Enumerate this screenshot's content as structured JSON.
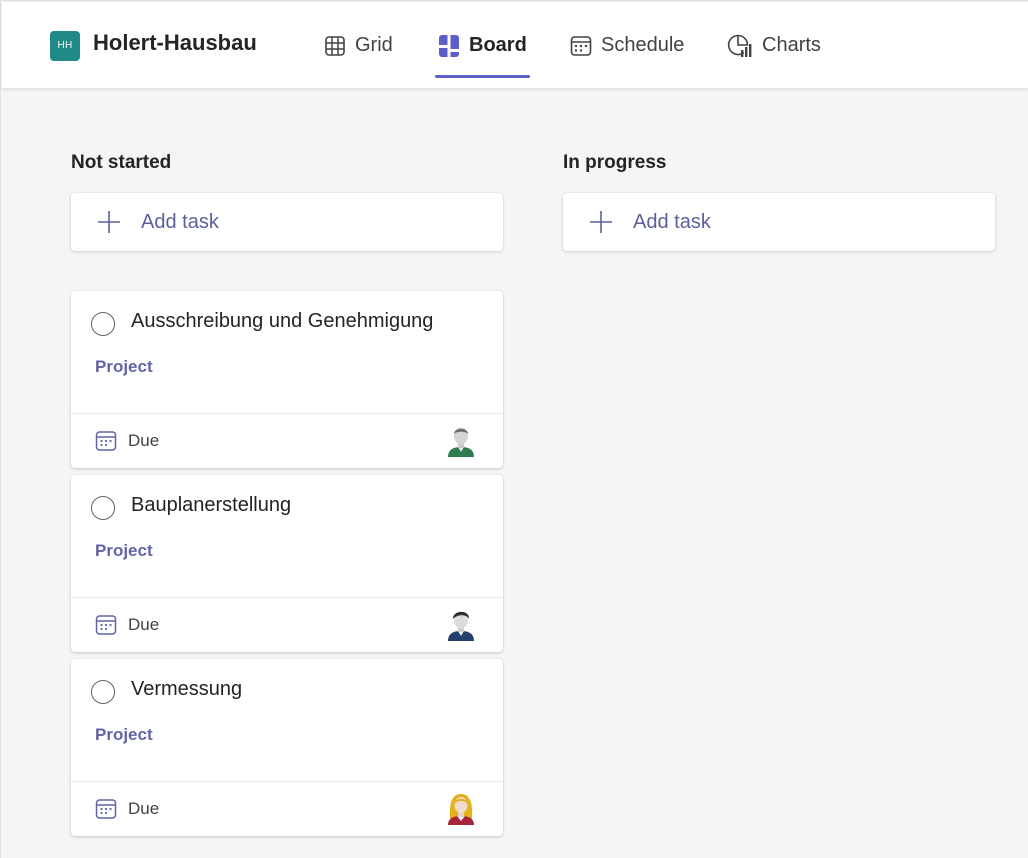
{
  "plan": {
    "initials": "HH",
    "title": "Holert-Hausbau"
  },
  "tabs": [
    {
      "label": "Grid",
      "icon": "grid-icon"
    },
    {
      "label": "Board",
      "icon": "board-icon",
      "active": true
    },
    {
      "label": "Schedule",
      "icon": "schedule-icon"
    },
    {
      "label": "Charts",
      "icon": "charts-icon"
    }
  ],
  "colors": {
    "accent": "#5b5fc7",
    "label": "#6264a7",
    "badge": "#1f8a87"
  },
  "columns": [
    {
      "title": "Not started",
      "add_label": "Add task",
      "tasks": [
        {
          "title": "Ausschreibung und Genehmigung",
          "label": "Project",
          "due": "Due",
          "assignee_icon": "male-avatar-green-icon"
        },
        {
          "title": "Bauplanerstellung",
          "label": "Project",
          "due": "Due",
          "assignee_icon": "male-avatar-blue-icon"
        },
        {
          "title": "Vermessung",
          "label": "Project",
          "due": "Due",
          "assignee_icon": "female-avatar-icon"
        }
      ]
    },
    {
      "title": "In progress",
      "add_label": "Add task",
      "tasks": []
    }
  ]
}
